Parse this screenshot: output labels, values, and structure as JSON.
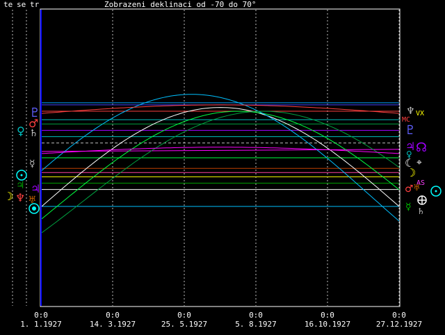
{
  "header": {
    "cols": [
      "te",
      "se",
      "tr"
    ],
    "title": "Zobrazeni deklinaci od -70 do 70°"
  },
  "colors": {
    "background": "#000000",
    "frame": "#ffffff",
    "axis": "#0000ff"
  },
  "time_axis": {
    "times": [
      "0:0",
      "0:0",
      "0:0",
      "0:0",
      "0:0",
      "0:0"
    ],
    "dates": [
      "1. 1.1927",
      "14. 3.1927",
      "25. 5.1927",
      "5. 8.1927",
      "16.10.1927",
      "27.12.1927"
    ]
  },
  "right_labels": {
    "vx": "VX",
    "mc": "MC",
    "as": "AS"
  },
  "chart_data": {
    "type": "line",
    "title": "Zobrazeni deklinaci od -70 do 70°",
    "ylim": [
      -70,
      70
    ],
    "x": [
      "1. 1.1927",
      "14. 3.1927",
      "25. 5.1927",
      "5. 8.1927",
      "16.10.1927",
      "27.12.1927"
    ],
    "grid": true,
    "series": [
      {
        "color": "#00a0ff",
        "start": 26,
        "end": 26
      },
      {
        "color": "#4040ff",
        "start": 25,
        "end": 25
      },
      {
        "color": "#ff4040",
        "start": 22,
        "end": 22
      },
      {
        "color": "#00c0c0",
        "start": 18,
        "end": 18
      },
      {
        "color": "#00a040",
        "start": 16,
        "end": 16
      },
      {
        "color": "#a000ff",
        "start": 13,
        "end": 13
      },
      {
        "color": "#00c0c0",
        "start": 10,
        "end": 10
      },
      {
        "color": "#c0c0c0",
        "start": 7,
        "end": 7,
        "dashed": true
      },
      {
        "color": "#ff00ff",
        "start": 3,
        "end": 4
      },
      {
        "color": "#00ff40",
        "start": 0,
        "end": 0
      },
      {
        "color": "#c04000",
        "start": -5,
        "end": -5
      },
      {
        "color": "#ff40a0",
        "start": -7,
        "end": -7
      },
      {
        "color": "#ffff00",
        "start": -9,
        "end": -9
      },
      {
        "color": "#00a000",
        "start": -12,
        "end": -12
      },
      {
        "color": "#00c0ff",
        "start": -23,
        "end": -23
      },
      {
        "color": "#ffffff",
        "start": -15,
        "end": -15
      }
    ]
  }
}
